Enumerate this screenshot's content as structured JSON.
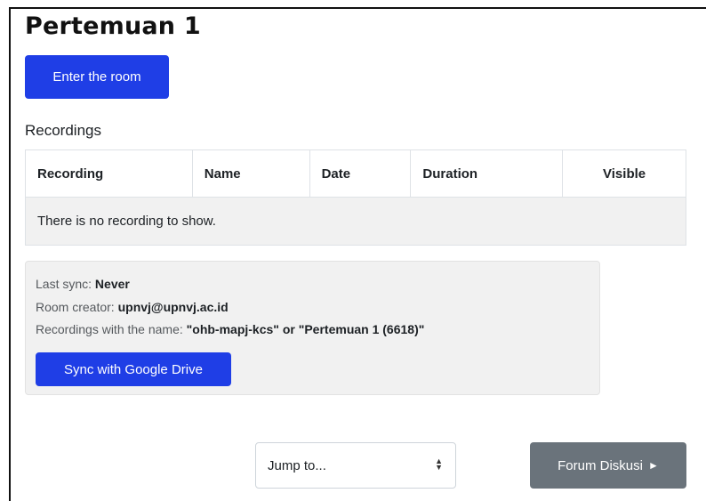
{
  "page_title": "Pertemuan 1",
  "enter_room_label": "Enter the room",
  "recordings": {
    "heading": "Recordings",
    "columns": [
      "Recording",
      "Name",
      "Date",
      "Duration",
      "Visible"
    ],
    "empty_message": "There is no recording to show."
  },
  "sync": {
    "last_sync_label": "Last sync: ",
    "last_sync_value": "Never",
    "room_creator_label": "Room creator: ",
    "room_creator_value": "upnvj@upnvj.ac.id",
    "recordings_name_label": "Recordings with the name: ",
    "recordings_name_value": "\"ohb-mapj-kcs\" or \"Pertemuan 1 (6618)\"",
    "button_label": "Sync with Google Drive"
  },
  "footer": {
    "jump_to_placeholder": "Jump to...",
    "next_activity_label": "Forum Diskusi",
    "next_icon": "►"
  },
  "colors": {
    "primary": "#1f3ee6",
    "secondary": "#6a737b",
    "panel_bg": "#f1f1f1"
  }
}
